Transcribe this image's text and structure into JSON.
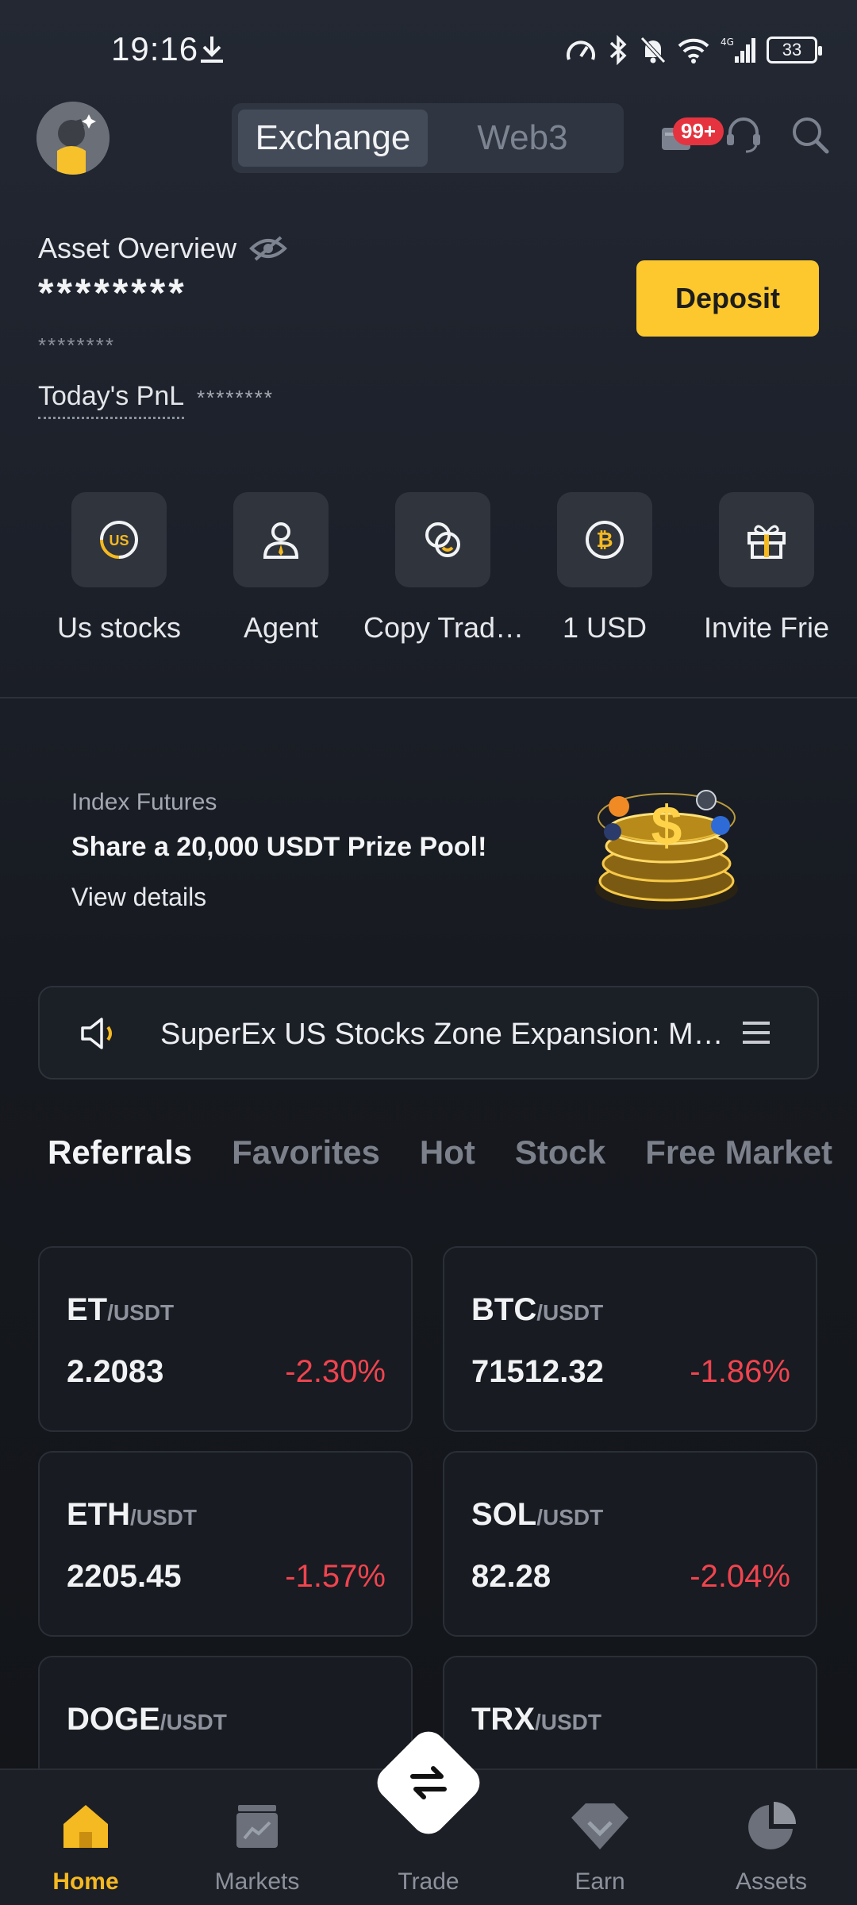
{
  "status_bar": {
    "time": "19:16",
    "battery": "33"
  },
  "header": {
    "tabs": [
      "Exchange",
      "Web3"
    ],
    "active_tab": "Exchange",
    "notification_badge": "99+"
  },
  "asset": {
    "label": "Asset Overview",
    "masked_value": "********",
    "masked_sub": "********",
    "pnl_label": "Today's PnL",
    "pnl_value": "********",
    "deposit_label": "Deposit"
  },
  "quick_actions": [
    {
      "label": "Us stocks",
      "icon": "us-stocks-icon"
    },
    {
      "label": "Agent",
      "icon": "agent-icon"
    },
    {
      "label": "Copy Trad…",
      "icon": "copy-trade-icon"
    },
    {
      "label": "1 USD",
      "icon": "bitcoin-icon"
    },
    {
      "label": "Invite Frie",
      "icon": "gift-icon"
    }
  ],
  "banner": {
    "kicker": "Index Futures",
    "title": "Share a 20,000 USDT Prize Pool!",
    "link": "View details"
  },
  "announcement": {
    "text": "SuperEx US Stocks Zone Expansion: M…"
  },
  "market_tabs": [
    "Referrals",
    "Favorites",
    "Hot",
    "Stock",
    "Free Market"
  ],
  "pairs": [
    {
      "base": "ET",
      "quote": "/USDT",
      "price": "2.2083",
      "change": "-2.30%"
    },
    {
      "base": "BTC",
      "quote": "/USDT",
      "price": "71512.32",
      "change": "-1.86%"
    },
    {
      "base": "ETH",
      "quote": "/USDT",
      "price": "2205.45",
      "change": "-1.57%"
    },
    {
      "base": "SOL",
      "quote": "/USDT",
      "price": "82.28",
      "change": "-2.04%"
    },
    {
      "base": "DOGE",
      "quote": "/USDT",
      "price": "",
      "change": ""
    },
    {
      "base": "TRX",
      "quote": "/USDT",
      "price": "",
      "change": ""
    }
  ],
  "bottom_nav": [
    {
      "label": "Home",
      "icon": "home-icon"
    },
    {
      "label": "Markets",
      "icon": "markets-icon"
    },
    {
      "label": "Trade",
      "icon": "trade-icon"
    },
    {
      "label": "Earn",
      "icon": "earn-icon"
    },
    {
      "label": "Assets",
      "icon": "assets-icon"
    }
  ],
  "colors": {
    "accent": "#fcc82d",
    "negative": "#f0444f",
    "nav_active": "#f5b921"
  }
}
